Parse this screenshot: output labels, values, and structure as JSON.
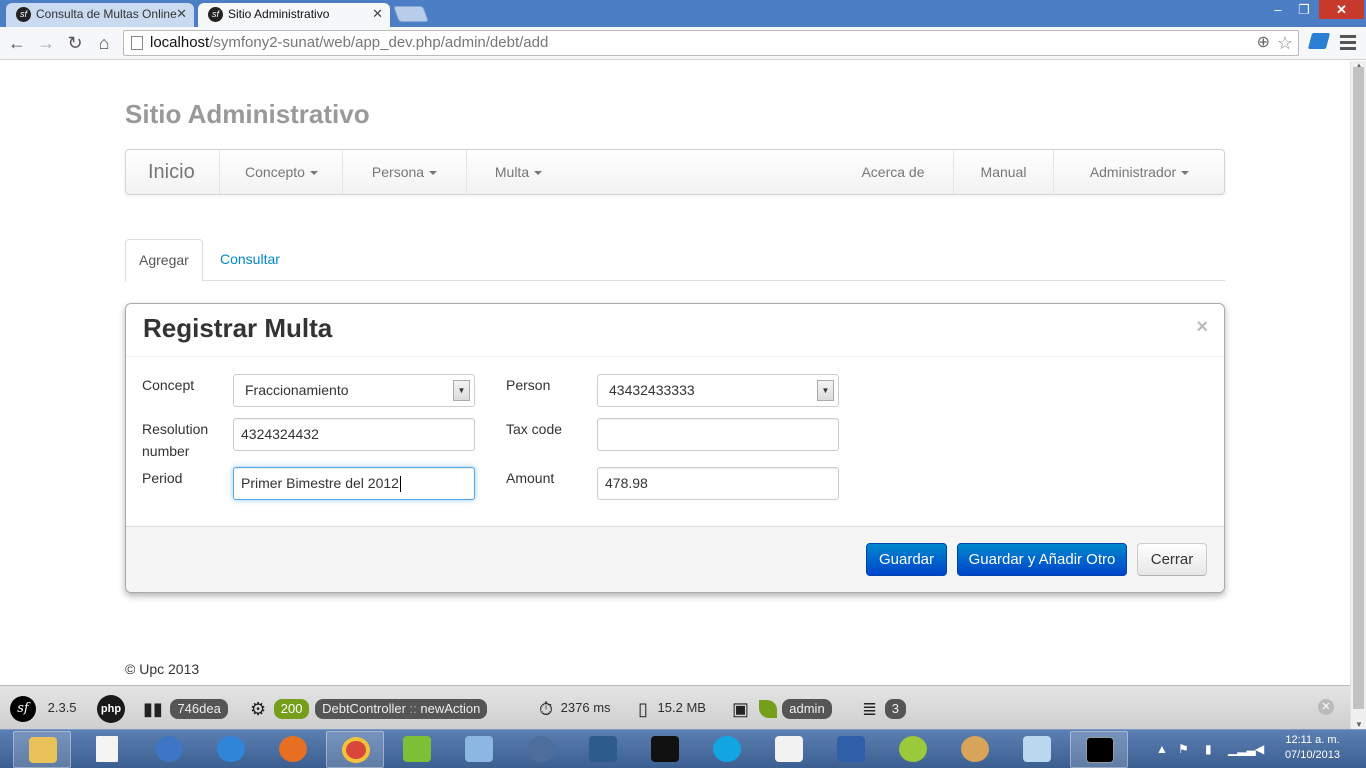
{
  "browser": {
    "tabs": [
      {
        "title": "Consulta de Multas Online",
        "active": false
      },
      {
        "title": "Sitio Administrativo",
        "active": true
      }
    ],
    "url_host": "localhost",
    "url_path": "/symfony2-sunat/web/app_dev.php/admin/debt/add"
  },
  "site": {
    "title": "Sitio Administrativo"
  },
  "navbar": {
    "brand": "Inicio",
    "left_items": [
      "Concepto",
      "Persona",
      "Multa"
    ],
    "right_items": [
      "Acerca de",
      "Manual",
      "Administrador"
    ]
  },
  "tabs": {
    "agregar": "Agregar",
    "consultar": "Consultar"
  },
  "modal": {
    "title": "Registrar Multa",
    "close": "×",
    "fields": {
      "concept": {
        "label": "Concept",
        "value": "Fraccionamiento"
      },
      "person": {
        "label": "Person",
        "value": "43432433333"
      },
      "resolution_number": {
        "label": "Resolution number",
        "value": "4324324432"
      },
      "tax_code": {
        "label": "Tax code",
        "value": ""
      },
      "period": {
        "label": "Period",
        "value": "Primer Bimestre del 2012"
      },
      "amount": {
        "label": "Amount",
        "value": "478.98"
      }
    },
    "buttons": {
      "save": "Guardar",
      "save_add": "Guardar y Añadir Otro",
      "close": "Cerrar"
    }
  },
  "footer": {
    "copyright": "© Upc 2013"
  },
  "debug_toolbar": {
    "symfony_version": "2.3.5",
    "php": "php",
    "token": "746dea",
    "status": "200",
    "controller": "DebtController",
    "action_sep": "::",
    "action": "newAction",
    "time": "2376 ms",
    "memory": "15.2 MB",
    "user": "admin",
    "queries": "3"
  },
  "taskbar": {
    "clock_time": "12:11 a. m.",
    "clock_date": "07/10/2013"
  },
  "colors": {
    "primary": "#0055cc",
    "link": "#0088cc",
    "focus": "#52a8ec",
    "symfony_green": "#759e1a"
  }
}
